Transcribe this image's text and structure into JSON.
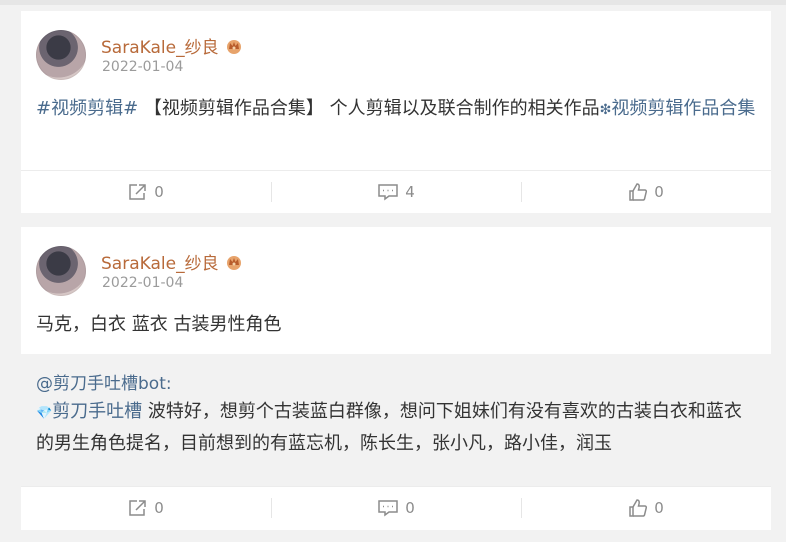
{
  "posts": [
    {
      "username": "SaraKale_纱良",
      "date": "2022-01-04",
      "content": {
        "tag1": "#视频剪辑#",
        "text": " 【视频剪辑作品合集】 个人剪辑以及联合制作的相关作品",
        "sparkle": "❇",
        "link": "视频剪辑作品合集"
      },
      "actions": {
        "repost": "0",
        "comment": "4",
        "like": "0"
      }
    },
    {
      "username": "SaraKale_纱良",
      "date": "2022-01-04",
      "content": {
        "text": "马克，白衣 蓝衣 古装男性角色"
      },
      "quote": {
        "author": "@剪刀手吐槽bot:",
        "badge": "剪刀手吐槽",
        "text": " 波特好，想剪个古装蓝白群像，想问下姐妹们有没有喜欢的古装白衣和蓝衣的男生角色提名，目前想到的有蓝忘机，陈长生，张小凡，路小佳，润玉"
      },
      "actions": {
        "repost": "0",
        "comment": "0",
        "like": "0"
      }
    }
  ],
  "icons": [
    "avatar",
    "crown-badge-icon",
    "repost-icon",
    "comment-icon",
    "like-icon",
    "diamond-icon"
  ]
}
